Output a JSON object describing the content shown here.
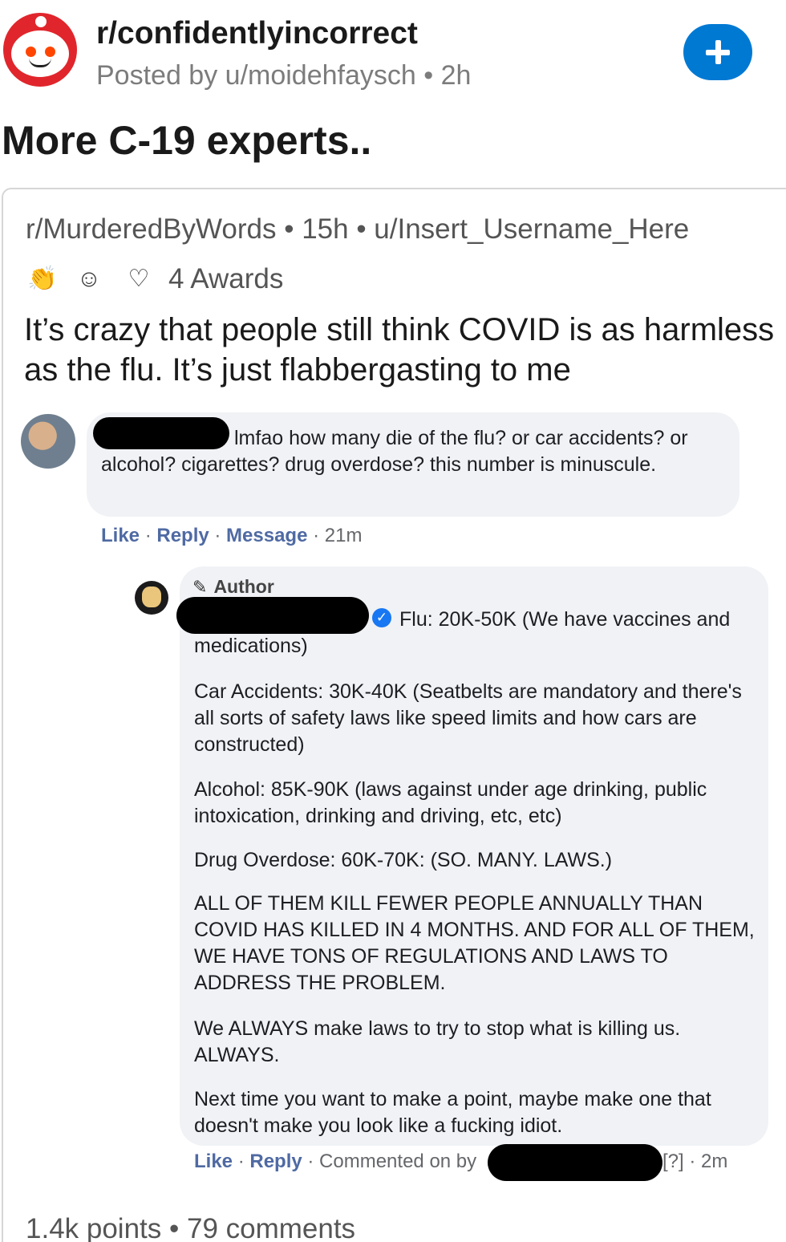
{
  "header": {
    "subreddit": "r/confidentlyincorrect",
    "posted_by": "Posted by u/moidehfaysch • 2h",
    "join_icon": "plus-icon",
    "brand_color": "#0079d3"
  },
  "post": {
    "title": "More C-19 experts.."
  },
  "crosspost": {
    "meta": "r/MurderedByWords • 15h • u/Insert_Username_Here",
    "awards_label": "4 Awards",
    "award_icons": [
      "clapping-hands-icon",
      "snoo-award-icon",
      "wholesome-award-icon"
    ],
    "title": "It’s crazy that people still think COVID is as harmless as the flu. It’s just flabbergasting to me"
  },
  "fb_comment_1": {
    "text": "lmfao how many die of the flu? or car accidents? or alcohol? cigarettes? drug overdose? this number is minuscule.",
    "like": "Like",
    "reply": "Reply",
    "message": "Message",
    "sep": " · ",
    "time": "21m"
  },
  "fb_comment_2": {
    "author_label": "Author",
    "p1": "Flu: 20K-50K (We have vaccines and medications)",
    "p2": "Car Accidents: 30K-40K (Seatbelts are mandatory and there's all sorts of safety laws like speed limits and how cars are constructed)",
    "p3": "Alcohol: 85K-90K (laws against under age drinking, public intoxication, drinking and driving, etc, etc)",
    "p4": "Drug Overdose: 60K-70K: (SO. MANY. LAWS.)",
    "p5": "ALL OF THEM KILL FEWER PEOPLE ANNUALLY THAN COVID HAS KILLED IN 4 MONTHS. AND FOR ALL OF THEM, WE HAVE TONS OF REGULATIONS AND LAWS TO ADDRESS THE PROBLEM.",
    "p6": "We ALWAYS make laws to try to stop what is killing us. ALWAYS.",
    "p7": "Next time you want to make a point, maybe make one that doesn't make you look like a fucking idiot.",
    "like": "Like",
    "reply": "Reply",
    "commented_on": "Commented on by",
    "sep": " · ",
    "time": "[?] · 2m"
  },
  "footer": {
    "stats": "1.4k points • 79 comments"
  }
}
